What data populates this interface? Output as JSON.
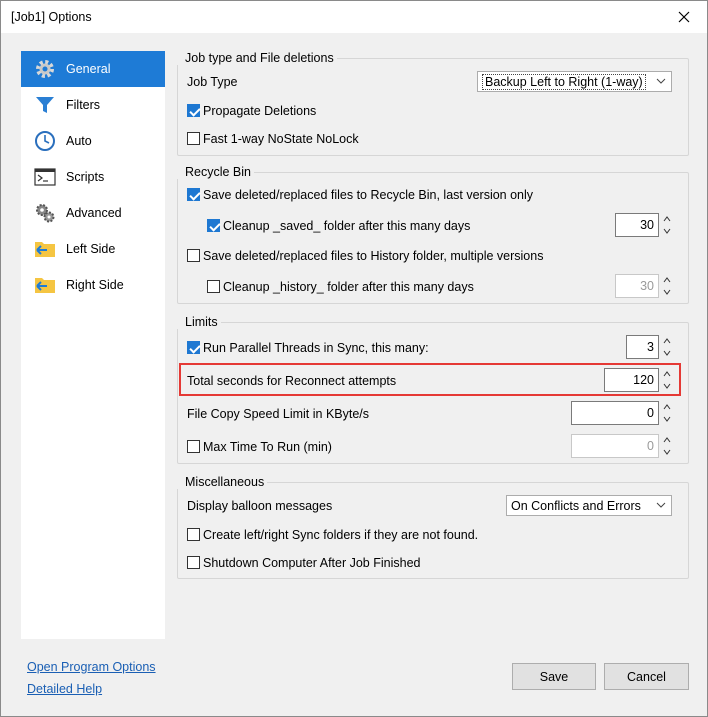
{
  "window": {
    "title": "[Job1] Options"
  },
  "sidebar": {
    "items": [
      {
        "label": "General",
        "icon": "gear-icon"
      },
      {
        "label": "Filters",
        "icon": "filter-icon"
      },
      {
        "label": "Auto",
        "icon": "clock-icon"
      },
      {
        "label": "Scripts",
        "icon": "console-icon"
      },
      {
        "label": "Advanced",
        "icon": "gears-icon"
      },
      {
        "label": "Left Side",
        "icon": "folder-left-icon"
      },
      {
        "label": "Right Side",
        "icon": "folder-right-icon"
      }
    ],
    "active_index": 0
  },
  "job_type": {
    "title": "Job type and File deletions",
    "job_type_label": "Job Type",
    "job_type_value": "Backup Left to Right (1-way)",
    "propagate_deletions": {
      "label": "Propagate Deletions",
      "checked": true
    },
    "fast_one_way": {
      "label": "Fast 1-way NoState NoLock",
      "checked": false
    }
  },
  "recycle_bin": {
    "title": "Recycle Bin",
    "save_recycle": {
      "label": "Save deleted/replaced files to Recycle Bin, last version only",
      "checked": true
    },
    "cleanup_saved": {
      "label": "Cleanup _saved_ folder after this many days",
      "checked": true,
      "value": "30"
    },
    "save_history": {
      "label": "Save deleted/replaced files to History folder, multiple versions",
      "checked": false
    },
    "cleanup_history": {
      "label": "Cleanup _history_ folder after this many days",
      "checked": false,
      "value": "30"
    }
  },
  "limits": {
    "title": "Limits",
    "parallel_threads": {
      "label": "Run Parallel Threads in Sync, this many:",
      "checked": true,
      "value": "3"
    },
    "reconnect": {
      "label": "Total seconds for Reconnect attempts",
      "value": "120"
    },
    "copy_speed": {
      "label": "File Copy Speed Limit in KByte/s",
      "value": "0"
    },
    "max_time": {
      "label": "Max Time To Run (min)",
      "checked": false,
      "value": "0"
    }
  },
  "misc": {
    "title": "Miscellaneous",
    "balloon_label": "Display balloon messages",
    "balloon_value": "On Conflicts and Errors",
    "create_folders": {
      "label": "Create left/right Sync folders if they are not found.",
      "checked": false
    },
    "shutdown": {
      "label": "Shutdown Computer After Job Finished",
      "checked": false
    }
  },
  "footer": {
    "open_program_options": "Open Program Options",
    "detailed_help": "Detailed Help",
    "save": "Save",
    "cancel": "Cancel"
  },
  "colors": {
    "accent": "#1e7bd6",
    "highlight": "#e53935",
    "link": "#1a5fb4"
  }
}
